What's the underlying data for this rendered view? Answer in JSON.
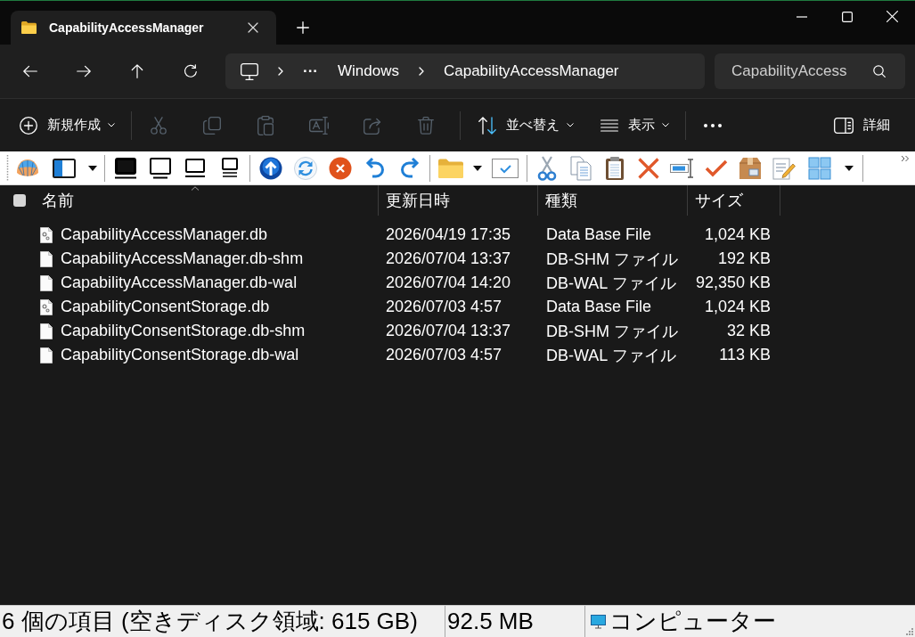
{
  "window": {
    "tabs": [
      {
        "title": "CapabilityAccessManager",
        "selected": true
      }
    ]
  },
  "address_bar": {
    "overflow": "···",
    "crumbs": [
      "Windows",
      "CapabilityAccessManager"
    ]
  },
  "search": {
    "placeholder": "CapabilityAccess"
  },
  "command_bar": [
    {
      "kind": "menu",
      "label": "新規作成",
      "disabled": false
    },
    {
      "kind": "separator"
    },
    {
      "kind": "icon",
      "disabled": true
    },
    {
      "kind": "icon",
      "disabled": true
    },
    {
      "kind": "icon",
      "disabled": true
    },
    {
      "kind": "icon",
      "disabled": true
    },
    {
      "kind": "icon",
      "disabled": true
    },
    {
      "kind": "icon",
      "disabled": true
    },
    {
      "kind": "separator"
    },
    {
      "kind": "menu",
      "label": "並べ替え",
      "disabled": false
    },
    {
      "kind": "menu",
      "label": "表示",
      "disabled": false
    },
    {
      "kind": "separator"
    },
    {
      "kind": "icon",
      "disabled": false
    },
    {
      "kind": "button",
      "label": "詳細",
      "disabled": false
    }
  ],
  "files": {
    "select_all": {
      "checked": false
    },
    "columns": [
      {
        "label": "名前",
        "sorted": true
      },
      {
        "label": "更新日時",
        "sorted": false
      },
      {
        "label": "種類",
        "sorted": false
      },
      {
        "label": "サイズ",
        "sorted": false
      }
    ],
    "rows": [
      {
        "kind": "db",
        "name": "CapabilityAccessManager.db",
        "modified": "2026/04/19 17:35",
        "type": "Data Base File",
        "size": "1,024 KB",
        "selected": false
      },
      {
        "kind": "file",
        "name": "CapabilityAccessManager.db-shm",
        "modified": "2026/07/04 13:37",
        "type": "DB-SHM ファイル",
        "size": "192 KB",
        "selected": false
      },
      {
        "kind": "file",
        "name": "CapabilityAccessManager.db-wal",
        "modified": "2026/07/04 14:20",
        "type": "DB-WAL ファイル",
        "size": "92,350 KB",
        "selected": false
      },
      {
        "kind": "db",
        "name": "CapabilityConsentStorage.db",
        "modified": "2026/07/03 4:57",
        "type": "Data Base File",
        "size": "1,024 KB",
        "selected": false
      },
      {
        "kind": "file",
        "name": "CapabilityConsentStorage.db-shm",
        "modified": "2026/07/04 13:37",
        "type": "DB-SHM ファイル",
        "size": "32 KB",
        "selected": false
      },
      {
        "kind": "file",
        "name": "CapabilityConsentStorage.db-wal",
        "modified": "2026/07/03 4:57",
        "type": "DB-WAL ファイル",
        "size": "113 KB",
        "selected": false
      }
    ]
  },
  "status_bar": {
    "summary": "6 個の項目 (空きディスク領域: 615 GB)",
    "size": "92.5 MB",
    "location": "コンピューター"
  }
}
